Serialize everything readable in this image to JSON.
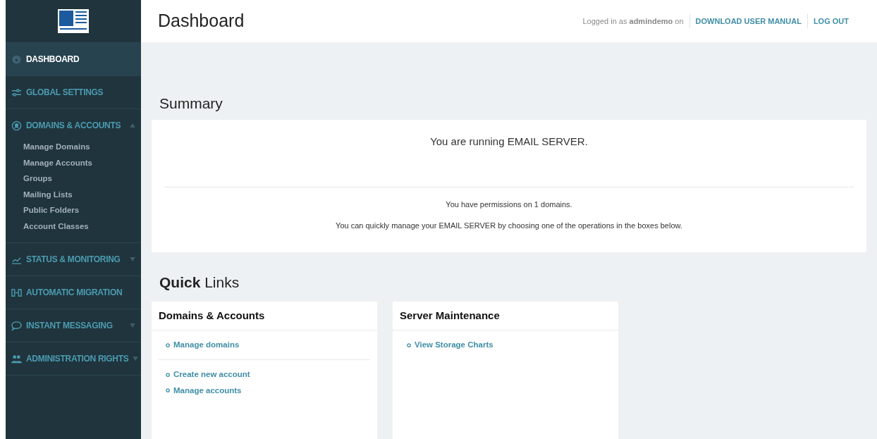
{
  "sidebar": {
    "items": [
      {
        "label": "DASHBOARD",
        "selected": true
      },
      {
        "label": "GLOBAL SETTINGS",
        "selected": false
      },
      {
        "label": "DOMAINS & ACCOUNTS",
        "selected": false,
        "expanded": true,
        "children": [
          {
            "label": "Manage Domains"
          },
          {
            "label": "Manage Accounts"
          },
          {
            "label": "Groups"
          },
          {
            "label": "Mailing Lists"
          },
          {
            "label": "Public Folders"
          },
          {
            "label": "Account Classes"
          }
        ]
      },
      {
        "label": "STATUS & MONITORING",
        "selected": false,
        "expanded": false
      },
      {
        "label": "AUTOMATIC MIGRATION",
        "selected": false
      },
      {
        "label": "INSTANT MESSAGING",
        "selected": false,
        "expanded": false
      },
      {
        "label": "ADMINISTRATION RIGHTS",
        "selected": false,
        "expanded": false
      }
    ]
  },
  "header": {
    "title": "Dashboard",
    "user_text": "Logged in as **admindemo** on",
    "links": [
      "DOWNLOAD USER MANUAL",
      "LOG OUT"
    ]
  },
  "summary": {
    "heading": "Summary",
    "main_text": "You are running EMAIL SERVER.",
    "lines": [
      "You have permissions on 1 domains.",
      "You can quickly manage your EMAIL SERVER by choosing one of the operations in the boxes below."
    ]
  },
  "quick_links": {
    "heading": "**Quick** Links",
    "cards": [
      {
        "title": "Domains & Accounts",
        "groups": [
          [
            "Manage domains"
          ],
          [
            "Create new account",
            "Manage accounts"
          ]
        ]
      },
      {
        "title": "Server Maintenance",
        "groups": [
          [
            "View Storage Charts"
          ]
        ]
      }
    ]
  }
}
